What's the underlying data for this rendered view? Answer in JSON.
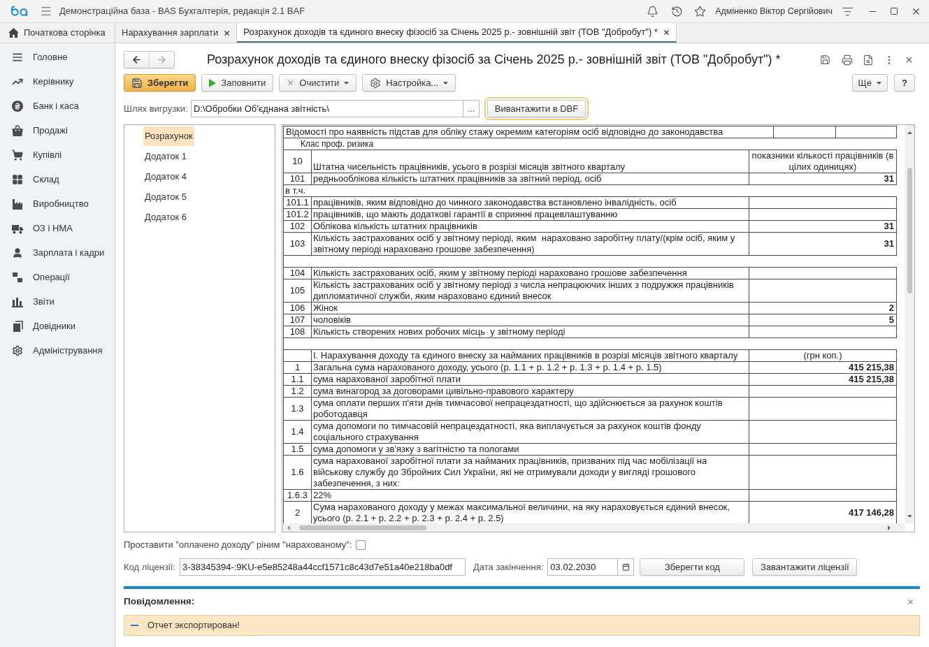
{
  "app_bar": {
    "title": "Демонстраційна база - BAS Бухгалтерія, редакція 2.1 BAF",
    "user": "Адміненко Віктор Сергійович"
  },
  "tabs": [
    {
      "kind": "home",
      "label": "Початкова сторінка",
      "selected": false,
      "closable": false
    },
    {
      "kind": "document",
      "label": "Нарахування зарплати",
      "selected": false,
      "closable": true
    },
    {
      "kind": "document",
      "label": "Розрахунок доходів та єдиного внеску фізосіб за Січень 2025 р.- зовнішній звіт (ТОВ \"Добробут\") *",
      "selected": true,
      "closable": true
    }
  ],
  "sidebar": {
    "items": [
      {
        "label": "Головне"
      },
      {
        "label": "Керівнику"
      },
      {
        "label": "Банк і каса"
      },
      {
        "label": "Продажі"
      },
      {
        "label": "Купівлі"
      },
      {
        "label": "Склад"
      },
      {
        "label": "Виробництво"
      },
      {
        "label": "ОЗ і НМА"
      },
      {
        "label": "Зарплата і кадри"
      },
      {
        "label": "Операції"
      },
      {
        "label": "Звіти"
      },
      {
        "label": "Довідники"
      },
      {
        "label": "Адміністрування"
      }
    ]
  },
  "form": {
    "nav": [
      {
        "kind": "back",
        "disabled": false
      },
      {
        "kind": "forward",
        "disabled": true
      }
    ],
    "title": "Розрахунок доходів та єдиного внеску фізосіб за Січень 2025 р.- зовнішній звіт (ТОВ \"Добробут\") *",
    "toolbar": [
      {
        "kind": "save",
        "label": "Зберегти",
        "default": true,
        "dropdown": false
      },
      {
        "kind": "fill",
        "label": "Заповнити",
        "default": false,
        "dropdown": false
      },
      {
        "kind": "clear",
        "label": "Очистити",
        "default": false,
        "dropdown": true
      },
      {
        "kind": "settings",
        "label": "Настройка...",
        "default": false,
        "dropdown": true
      }
    ],
    "more_button": "Ще",
    "help_button": "?",
    "export": {
      "label": "Шлях вигрузки:",
      "value": "D:\\Обробки Об'єднана звітність\\",
      "browse": "...",
      "button": "Вивантажити в DBF",
      "focused": true
    }
  },
  "sections": [
    {
      "label": "Розрахунок",
      "selected": true
    },
    {
      "label": "Додаток 1",
      "selected": false
    },
    {
      "label": "Додаток 4",
      "selected": false
    },
    {
      "label": "Додаток 5",
      "selected": false
    },
    {
      "label": "Додаток 6",
      "selected": false
    }
  ],
  "report": {
    "rows": [
      {
        "kind": "title",
        "text": "Відомості про наявність підстав для обліку стажу окремим категоріям осіб відповідно до законодавства"
      },
      {
        "kind": "caption",
        "text": "Клас проф. ризика"
      },
      {
        "kind": "heading",
        "code": "10",
        "text": "Штатна чисельність працівників, усього в розрізі місяців звітного кварталу",
        "value": "показники кількості працівників (в цілих одиницях)"
      },
      {
        "kind": "line",
        "code": "101",
        "text": "редньооблікова кількість штатних працівників за звітний період, осіб",
        "value": "31"
      },
      {
        "kind": "note",
        "text": "в т.ч."
      },
      {
        "kind": "line",
        "code": "101.1",
        "text": "працівників, яким відповідно до чинного законодавства встановлено інвалідність, осіб"
      },
      {
        "kind": "line",
        "code": "101.2",
        "text": "працівників, що мають додаткові гарантії в сприянні працевлаштуванню"
      },
      {
        "kind": "line",
        "code": "102",
        "text": "Облікова кількість штатних працівників",
        "value": "31"
      },
      {
        "kind": "line",
        "code": "103",
        "text": "Кількість застрахованих осіб у звітному періоді, яким  нараховано заробітну плату/(крім осіб, яким у звітному періоді нараховано грошове забезпечення)",
        "value": "31"
      },
      {
        "kind": "spacer"
      },
      {
        "kind": "line",
        "code": "104",
        "text": "Кількість застрахованих осіб, яким у звітному періоді нараховано грошове забезпечення"
      },
      {
        "kind": "line",
        "code": "105",
        "text": "Кількість застрахованих осіб у звітному періоді з числа непрацюючих інших з подружжя працівників дипломатичної служби, яким нараховано єдиний внесок"
      },
      {
        "kind": "line",
        "code": "106",
        "text": "Жінок",
        "value": "2"
      },
      {
        "kind": "line",
        "code": "107",
        "text": "чоловіків",
        "value": "5"
      },
      {
        "kind": "line",
        "code": "108",
        "text": "Кількість створених нових робочих місць  у звітному періоді"
      },
      {
        "kind": "spacer"
      },
      {
        "kind": "heading",
        "text": "І. Нарахування доходу та єдиного внеску за найманих працівників в розрізі місяців звітного кварталу",
        "value": "(грн коп.)"
      },
      {
        "kind": "line",
        "code": "1",
        "text": "Загальна сума нарахованого доходу, усього (р. 1.1 + р. 1.2 + р. 1.3 + р. 1.4 + р. 1.5)",
        "value": "415 215,38"
      },
      {
        "kind": "line",
        "code": "1.1",
        "text": "сума нарахованої заробітної плати",
        "value": "415 215,38"
      },
      {
        "kind": "line",
        "code": "1.2",
        "text": "сума винагород за договорами цивільно-правового характеру"
      },
      {
        "kind": "line",
        "code": "1.3",
        "text": "сума оплати перших п'яти днів тимчасової непрацездатності, що здійснюється за рахунок коштів роботодавця"
      },
      {
        "kind": "line",
        "code": "1.4",
        "text": "сума допомоги по тимчасовій непрацездатності, яка виплачується за рахунок коштів фонду соціального страхування"
      },
      {
        "kind": "line",
        "code": "1.5",
        "text": "сума допомоги у зв'язку з вагітністю та пологами"
      },
      {
        "kind": "line",
        "code": "1.6",
        "text": "сума нарахованої заробітної плати за найманих працівників, призваних під час мобілізації на військову службу до Збройних Сил України, які не отримували доходи у вигляді грошового забезпечення, з них:"
      },
      {
        "kind": "line",
        "code": "1.6.3",
        "text": "22%"
      },
      {
        "kind": "line",
        "code": "2",
        "text": "Сума нарахованого доходу у межах максимальної величини, на яку нараховується єдиний внесок, усього (р. 2.1 + р. 2.2 + р. 2.3 + р. 2.4 + р. 2.5)",
        "value": "417 146,28"
      }
    ]
  },
  "paid_checkbox": {
    "label": "Проставити \"оплачено доходу\" ріним \"нарахованому\":",
    "checked": false
  },
  "license": {
    "label": "Код ліцензії:",
    "value": "3-38345394-:9KU-e5e85248a44ccf1571c8c43d7e51a40e218ba0df",
    "expiry_label": "Дата закінчення:",
    "expiry_value": "03.02.2030",
    "save_button": "Зберегти код",
    "load_button": "Завантажити ліцензії"
  },
  "messages": {
    "title": "Повідомлення:",
    "items": [
      {
        "text": "Отчет экспортирован!"
      }
    ]
  }
}
